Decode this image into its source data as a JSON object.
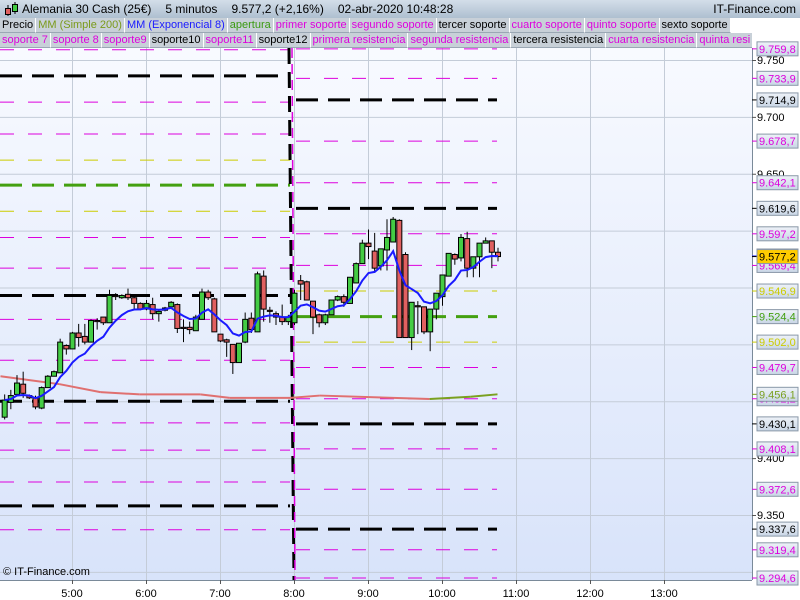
{
  "header": {
    "instrument": "Alemania 30 Cash (25€)",
    "timeframe": "5 minutos",
    "last": "9.577,2 (+2,16%)",
    "datetime": "02-abr-2020 10:48:28",
    "brand": "IT-Finance.com"
  },
  "legend": {
    "row1": [
      {
        "label": "Precio",
        "color": "#000000"
      },
      {
        "label": "MM (Simple 200)",
        "color": "#7a9a1a"
      },
      {
        "label": "MM (Exponencial 8)",
        "color": "#1a1aff"
      },
      {
        "label": "apertura",
        "color": "#3a9a10"
      },
      {
        "label": "primer soporte",
        "color": "#dd00dd"
      },
      {
        "label": "segundo soporte",
        "color": "#dd00dd"
      },
      {
        "label": "tercer soporte",
        "color": "#000000"
      },
      {
        "label": "cuarto soporte",
        "color": "#dd00dd"
      },
      {
        "label": "quinto soporte",
        "color": "#dd00dd"
      },
      {
        "label": "sexto soporte",
        "color": "#000000"
      }
    ],
    "row2": [
      {
        "label": "soporte 7",
        "color": "#dd00dd"
      },
      {
        "label": "soporte 8",
        "color": "#dd00dd"
      },
      {
        "label": "soporte9",
        "color": "#dd00dd"
      },
      {
        "label": "soporte10",
        "color": "#000000"
      },
      {
        "label": "soporte11",
        "color": "#dd00dd"
      },
      {
        "label": "soporte12",
        "color": "#000000"
      },
      {
        "label": "primera resistencia",
        "color": "#dd00dd"
      },
      {
        "label": "segunda resistencia",
        "color": "#dd00dd"
      },
      {
        "label": "tercera resistencia",
        "color": "#000000"
      },
      {
        "label": "cuarta resistencia",
        "color": "#dd00dd"
      },
      {
        "label": "quinta resi",
        "color": "#dd00dd"
      }
    ]
  },
  "copyright": "© IT-Finance.com",
  "chart_data": {
    "type": "candlestick",
    "title": "Alemania 30 Cash (25€) 5 minutos",
    "x_ticks": [
      "5:00",
      "6:00",
      "7:00",
      "8:00",
      "9:00",
      "10:00",
      "11:00",
      "12:00",
      "13:00"
    ],
    "y_tick_labels": [
      {
        "v": 9750,
        "t": "9.750"
      },
      {
        "v": 9700,
        "t": "9.700"
      },
      {
        "v": 9650,
        "t": "9.650"
      },
      {
        "v": 9400,
        "t": "9.400"
      },
      {
        "v": 9350,
        "t": "9.350"
      }
    ],
    "y_grid": [
      9750,
      9700,
      9650,
      9600,
      9550,
      9500,
      9450,
      9400,
      9350,
      9300
    ],
    "ylim": [
      9282,
      9760
    ],
    "colors": {
      "up": "#44cc44",
      "down": "#e06060",
      "ema": "#1a1aff",
      "sma": "#e07070",
      "sma_rising": "#7aa020",
      "black": "#000000",
      "magenta": "#dd00dd",
      "yellow": "#cccc00",
      "green": "#44a010",
      "current": "#ffcc00"
    },
    "candles": [
      [
        "4:05",
        9436,
        9456,
        9434,
        9451
      ],
      [
        "4:10",
        9449,
        9460,
        9443,
        9455
      ],
      [
        "4:15",
        9456,
        9473,
        9456,
        9466
      ],
      [
        "4:20",
        9465,
        9476,
        9453,
        9457
      ],
      [
        "4:25",
        9455,
        9456,
        9452,
        9453
      ],
      [
        "4:30",
        9453,
        9455,
        9443,
        9445
      ],
      [
        "4:35",
        9444,
        9463,
        9443,
        9462
      ],
      [
        "4:40",
        9462,
        9473,
        9462,
        9472
      ],
      [
        "4:45",
        9472,
        9477,
        9472,
        9476
      ],
      [
        "4:50",
        9475,
        9505,
        9475,
        9502
      ],
      [
        "4:55",
        9499,
        9500,
        9491,
        9496
      ],
      [
        "5:00",
        9496,
        9511,
        9496,
        9510
      ],
      [
        "5:05",
        9510,
        9518,
        9498,
        9506
      ],
      [
        "5:10",
        9507,
        9518,
        9500,
        9502
      ],
      [
        "5:15",
        9502,
        9522,
        9502,
        9521
      ],
      [
        "5:20",
        9521,
        9523,
        9513,
        9520
      ],
      [
        "5:25",
        9524,
        9524,
        9517,
        9519
      ],
      [
        "5:30",
        9519,
        9548,
        9519,
        9543
      ],
      [
        "5:35",
        9543,
        9545,
        9539,
        9542
      ],
      [
        "5:40",
        9541,
        9544,
        9540,
        9543
      ],
      [
        "5:45",
        9544,
        9549,
        9539,
        9541
      ],
      [
        "5:50",
        9541,
        9544,
        9531,
        9536
      ],
      [
        "5:55",
        9536,
        9537,
        9530,
        9531
      ],
      [
        "6:00",
        9531,
        9539,
        9530,
        9536
      ],
      [
        "6:05",
        9535,
        9541,
        9522,
        9527
      ],
      [
        "6:10",
        9527,
        9531,
        9520,
        9529
      ],
      [
        "6:15",
        9530,
        9533,
        9529,
        9532
      ],
      [
        "6:20",
        9533,
        9538,
        9531,
        9537
      ],
      [
        "6:25",
        9535,
        9536,
        9510,
        9514
      ],
      [
        "6:30",
        9515,
        9522,
        9502,
        9514
      ],
      [
        "6:35",
        9515,
        9520,
        9509,
        9513
      ],
      [
        "6:40",
        9512,
        9526,
        9512,
        9524
      ],
      [
        "6:45",
        9522,
        9549,
        9522,
        9546
      ],
      [
        "6:50",
        9546,
        9548,
        9539,
        9541
      ],
      [
        "6:55",
        9540,
        9541,
        9511,
        9511
      ],
      [
        "7:00",
        9509,
        9509,
        9502,
        9503
      ],
      [
        "7:05",
        9504,
        9505,
        9489,
        9502
      ],
      [
        "7:10",
        9500,
        9500,
        9474,
        9484
      ],
      [
        "7:15",
        9484,
        9501,
        9484,
        9501
      ],
      [
        "7:20",
        9502,
        9528,
        9501,
        9522
      ],
      [
        "7:25",
        9523,
        9528,
        9510,
        9513
      ],
      [
        "7:30",
        9511,
        9564,
        9511,
        9562
      ],
      [
        "7:35",
        9560,
        9565,
        9520,
        9531
      ],
      [
        "7:40",
        9530,
        9533,
        9519,
        9529
      ],
      [
        "7:45",
        9527,
        9529,
        9517,
        9524
      ],
      [
        "7:50",
        9524,
        9535,
        9517,
        9520
      ],
      [
        "7:55",
        9520,
        9526,
        9517,
        9524
      ],
      [
        "8:00",
        9519,
        9548,
        9517,
        9545
      ],
      [
        "8:05",
        9556,
        9561,
        9539,
        9553
      ],
      [
        "8:10",
        9555,
        9556,
        9539,
        9539
      ],
      [
        "8:15",
        9538,
        9538,
        9509,
        9524
      ],
      [
        "8:20",
        9526,
        9527,
        9515,
        9519
      ],
      [
        "8:25",
        9519,
        9527,
        9517,
        9526
      ],
      [
        "8:30",
        9526,
        9539,
        9526,
        9539
      ],
      [
        "8:35",
        9539,
        9543,
        9538,
        9542
      ],
      [
        "8:40",
        9542,
        9544,
        9533,
        9537
      ],
      [
        "8:45",
        9536,
        9559,
        9536,
        9559
      ],
      [
        "8:50",
        9554,
        9572,
        9554,
        9571
      ],
      [
        "8:55",
        9571,
        9592,
        9571,
        9589
      ],
      [
        "9:00",
        9589,
        9601,
        9575,
        9586
      ],
      [
        "9:05",
        9582,
        9598,
        9563,
        9567
      ],
      [
        "9:10",
        9569,
        9584,
        9565,
        9584
      ],
      [
        "9:15",
        9583,
        9610,
        9565,
        9594
      ],
      [
        "9:20",
        9590,
        9612,
        9590,
        9610
      ],
      [
        "9:25",
        9609,
        9610,
        9506,
        9506
      ],
      [
        "9:30",
        9579,
        9581,
        9506,
        9506
      ],
      [
        "9:35",
        9506,
        9537,
        9495,
        9537
      ],
      [
        "9:40",
        9534,
        9538,
        9509,
        9533
      ],
      [
        "9:45",
        9533,
        9533,
        9509,
        9511
      ],
      [
        "9:50",
        9511,
        9531,
        9494,
        9531
      ],
      [
        "9:55",
        9531,
        9545,
        9522,
        9545
      ],
      [
        "10:00",
        9542,
        9561,
        9534,
        9561
      ],
      [
        "10:05",
        9560,
        9580,
        9560,
        9580
      ],
      [
        "10:10",
        9579,
        9580,
        9570,
        9575
      ],
      [
        "10:15",
        9576,
        9597,
        9573,
        9594
      ],
      [
        "10:20",
        9593,
        9599,
        9559,
        9567
      ],
      [
        "10:25",
        9567,
        9577,
        9559,
        9577
      ],
      [
        "10:30",
        9577,
        9589,
        9559,
        9589
      ],
      [
        "10:35",
        9589,
        9594,
        9589,
        9591
      ],
      [
        "10:40",
        9591,
        9591,
        9567,
        9581
      ],
      [
        "10:45",
        9581,
        9585,
        9573,
        9577.2
      ]
    ],
    "sma200": [
      [
        "4:02",
        9472
      ],
      [
        "4:50",
        9465
      ],
      [
        "5:23",
        9458
      ],
      [
        "5:55",
        9456
      ],
      [
        "6:44",
        9456
      ],
      [
        "7:08",
        9453
      ],
      [
        "7:57",
        9453
      ],
      [
        "8:21",
        9455
      ],
      [
        "9:50",
        9452
      ],
      [
        "10:23",
        9454
      ],
      [
        "10:45",
        9456.1
      ]
    ],
    "levels_previous": [
      {
        "p": 9759,
        "c": "magenta"
      },
      {
        "p": 9736,
        "c": "black"
      },
      {
        "p": 9713,
        "c": "magenta"
      },
      {
        "p": 9685,
        "c": "magenta"
      },
      {
        "p": 9662,
        "c": "yellow"
      },
      {
        "p": 9640,
        "c": "green"
      },
      {
        "p": 9617,
        "c": "yellow"
      },
      {
        "p": 9594,
        "c": "magenta"
      },
      {
        "p": 9567,
        "c": "magenta"
      },
      {
        "p": 9543,
        "c": "black"
      },
      {
        "p": 9522,
        "c": "magenta"
      },
      {
        "p": 9486,
        "c": "magenta"
      },
      {
        "p": 9450,
        "c": "black"
      },
      {
        "p": 9431,
        "c": "magenta"
      },
      {
        "p": 9407,
        "c": "magenta"
      },
      {
        "p": 9379,
        "c": "magenta"
      },
      {
        "p": 9358,
        "c": "black"
      },
      {
        "p": 9337,
        "c": "magenta"
      }
    ],
    "levels_current": [
      {
        "p": 9759.8,
        "t": "9.759,8",
        "c": "magenta"
      },
      {
        "p": 9733.9,
        "t": "9.733,9",
        "c": "magenta"
      },
      {
        "p": 9714.9,
        "t": "9.714,9",
        "c": "black"
      },
      {
        "p": 9678.7,
        "t": "9.678,7",
        "c": "magenta"
      },
      {
        "p": 9642.1,
        "t": "9.642,1",
        "c": "magenta"
      },
      {
        "p": 9619.6,
        "t": "9.619,6",
        "c": "black"
      },
      {
        "p": 9597.2,
        "t": "9.597,2",
        "c": "magenta"
      },
      {
        "p": 9569.4,
        "t": "9.569,4",
        "c": "magenta"
      },
      {
        "p": 9546.9,
        "t": "9.546,9",
        "c": "yellow"
      },
      {
        "p": 9524.4,
        "t": "9.524,4",
        "c": "green"
      },
      {
        "p": 9502.0,
        "t": "9.502,0",
        "c": "yellow"
      },
      {
        "p": 9479.7,
        "t": "9.479,7",
        "c": "magenta"
      },
      {
        "p": 9452.2,
        "t": "9.452,2",
        "c": "magenta"
      },
      {
        "p": 9430.1,
        "t": "9.430,1",
        "c": "black"
      },
      {
        "p": 9408.1,
        "t": "9.408,1",
        "c": "magenta"
      },
      {
        "p": 9372.6,
        "t": "9.372,6",
        "c": "magenta"
      },
      {
        "p": 9337.6,
        "t": "9.337,6",
        "c": "black"
      },
      {
        "p": 9319.4,
        "t": "9.319,4",
        "c": "magenta"
      },
      {
        "p": 9294.6,
        "t": "9.294,6",
        "c": "magenta"
      }
    ],
    "sma_label": {
      "p": 9456.1,
      "t": "9.456,1"
    },
    "ema_label": {
      "p": 9577.7,
      "t": "9.577,7"
    },
    "current_price": {
      "p": 9577.2,
      "t": "9.577,2"
    }
  }
}
